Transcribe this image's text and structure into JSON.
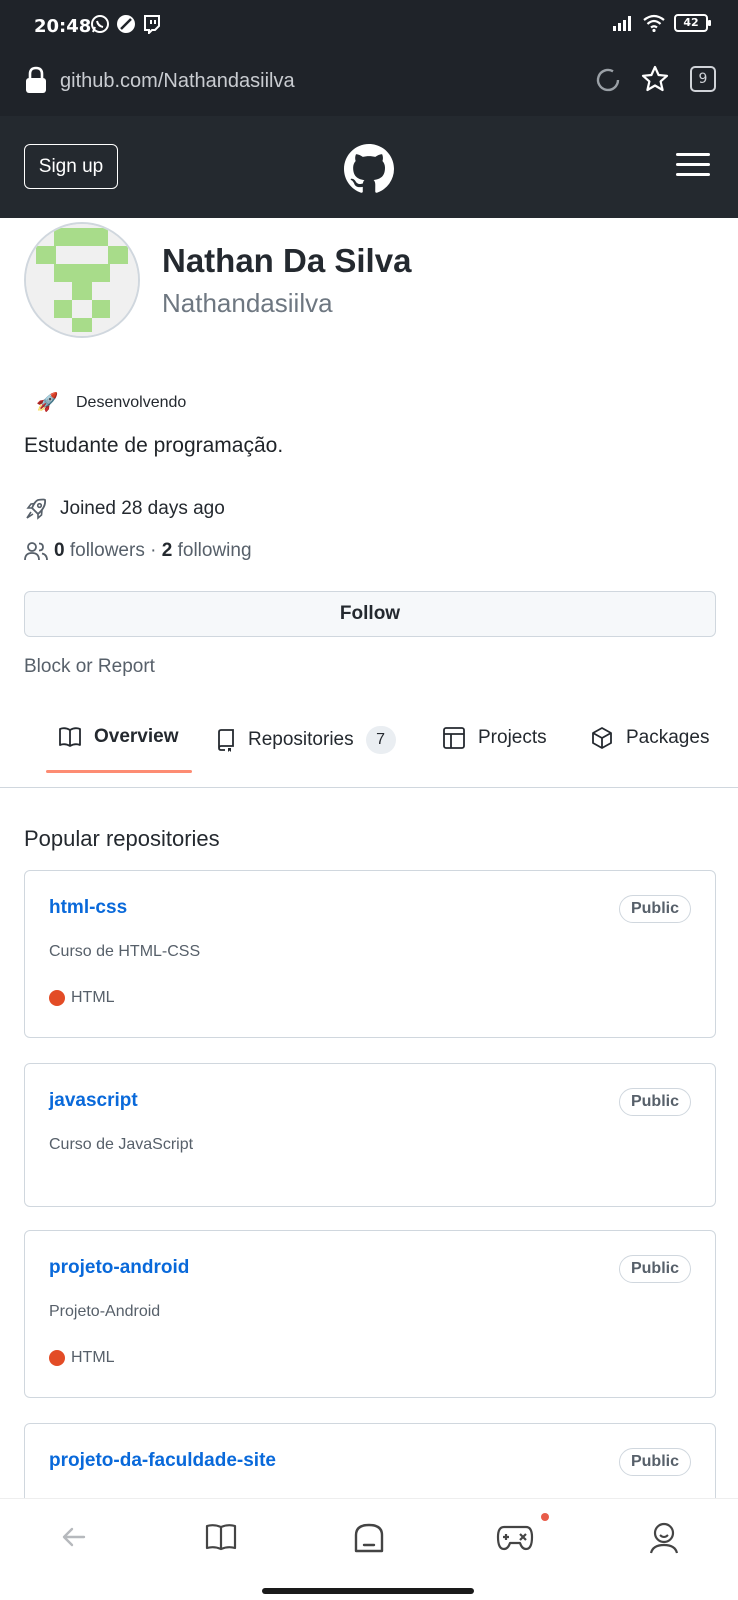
{
  "status_bar": {
    "time": "20:48",
    "battery": "42"
  },
  "browser": {
    "url": "github.com/Nathandasiilva",
    "tab_count": "9"
  },
  "header": {
    "signup_label": "Sign up"
  },
  "profile": {
    "full_name": "Nathan Da Silva",
    "username": "Nathandasiilva",
    "status_emoji": "🚀",
    "status_text": "Desenvolvendo",
    "bio": "Estudante de programação.",
    "joined": "Joined 28 days ago",
    "followers_count": "0",
    "followers_label": "followers",
    "separator": "·",
    "following_count": "2",
    "following_label": "following",
    "follow_label": "Follow",
    "block_label": "Block or Report"
  },
  "tabs": [
    {
      "label": "Overview"
    },
    {
      "label": "Repositories",
      "count": "7"
    },
    {
      "label": "Projects"
    },
    {
      "label": "Packages"
    }
  ],
  "popular_title": "Popular repositories",
  "repos": [
    {
      "name": "html-css",
      "visibility": "Public",
      "description": "Curso de HTML-CSS",
      "language": "HTML",
      "lang_color": "#e34c26"
    },
    {
      "name": "javascript",
      "visibility": "Public",
      "description": "Curso de JavaScript"
    },
    {
      "name": "projeto-android",
      "visibility": "Public",
      "description": "Projeto-Android",
      "language": "HTML",
      "lang_color": "#e34c26"
    },
    {
      "name": "projeto-da-faculdade-site",
      "visibility": "Public"
    }
  ],
  "icons": {
    "whatsapp": "whatsapp-icon",
    "notif2": "blocked-icon",
    "twitch": "twitch-icon",
    "signal": "signal-icon",
    "wifi": "wifi-icon",
    "lock": "lock-icon",
    "reload": "reload-icon",
    "star": "star-icon",
    "github": "github-logo",
    "menu": "hamburger-icon",
    "rocket": "rocket-icon",
    "people": "people-icon",
    "book": "book-icon",
    "repo": "repo-icon",
    "table": "table-icon",
    "package": "package-icon",
    "back": "back-arrow-icon",
    "reader": "book-open-icon",
    "home": "home-icon",
    "game": "gamepad-icon",
    "account": "account-icon"
  },
  "colors": {
    "header_bg": "#24292f",
    "link": "#0969da",
    "active_tab_underline": "#fd8c73",
    "avatar_green": "#a8dc8a"
  }
}
